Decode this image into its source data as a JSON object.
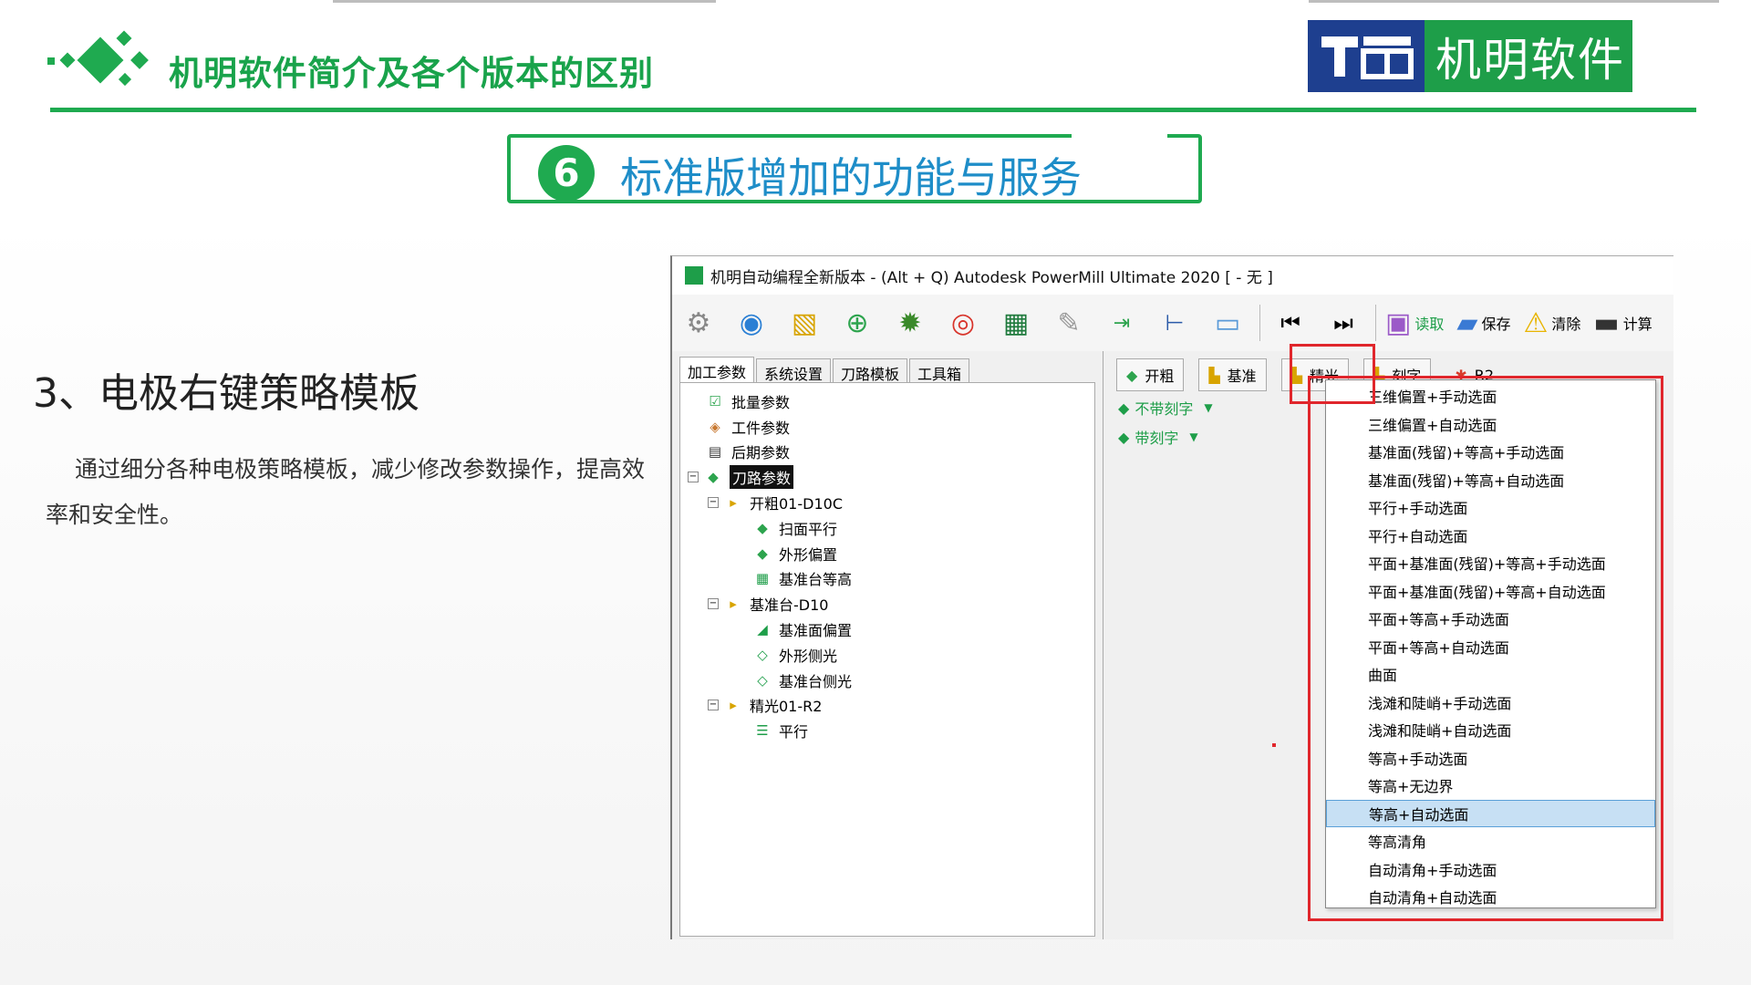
{
  "slide": {
    "title": "机明软件简介及各个版本的区别",
    "brand": "机明软件",
    "section_number": "6",
    "section_title": "标准版增加的功能与服务",
    "feature_heading": "3、电极右键策略模板",
    "feature_desc": "通过细分各种电极策略模板，减少修改参数操作，提高效率和安全性。"
  },
  "app": {
    "title": "机明自动编程全新版本 - (Alt + Q) Autodesk PowerMill Ultimate 2020    [ - 无 ]",
    "toolbar": {
      "icons": [
        "gear-icon",
        "globe-icon",
        "chart-icon",
        "add-icon",
        "cog-icon",
        "target-icon",
        "excel-icon",
        "wrench-icon",
        "import-icon",
        "tree-icon",
        "folder-icon",
        "first-icon",
        "last-icon"
      ],
      "read": "读取",
      "save": "保存",
      "clear": "清除",
      "calc": "计算"
    },
    "tabs": [
      "加工参数",
      "系统设置",
      "刀路模板",
      "工具箱"
    ],
    "tree": {
      "items": [
        "批量参数",
        "工件参数",
        "后期参数",
        "刀路参数"
      ],
      "groups": [
        {
          "label": "开粗01-D10C",
          "children": [
            "扫面平行",
            "外形偏置",
            "基准台等高"
          ]
        },
        {
          "label": "基准台-D10",
          "children": [
            "基准面偏置",
            "外形侧光",
            "基准台侧光"
          ]
        },
        {
          "label": "精光01-R2",
          "children": [
            "平行"
          ]
        }
      ]
    },
    "buttons": {
      "rough": "开粗",
      "base": "基准",
      "finish": "精光",
      "engrave": "刻字",
      "r2": "R2"
    },
    "status": {
      "no_engrave": "不带刻字",
      "with_engrave": "带刻字"
    },
    "menu": {
      "items": [
        "三维偏置+手动选面",
        "三维偏置+自动选面",
        "基准面(残留)+等高+手动选面",
        "基准面(残留)+等高+自动选面",
        "平行+手动选面",
        "平行+自动选面",
        "平面+基准面(残留)+等高+手动选面",
        "平面+基准面(残留)+等高+自动选面",
        "平面+等高+手动选面",
        "平面+等高+自动选面",
        "曲面",
        "浅滩和陡峭+手动选面",
        "浅滩和陡峭+自动选面",
        "等高+手动选面",
        "等高+无边界",
        "等高+自动选面",
        "等高清角",
        "自动清角+手动选面",
        "自动清角+自动选面"
      ],
      "highlighted": "等高+自动选面"
    }
  }
}
